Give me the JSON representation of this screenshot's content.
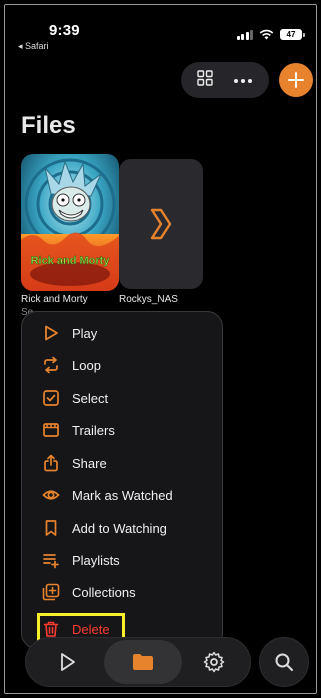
{
  "status_bar": {
    "time": "9:39",
    "back_app": "◂ Safari",
    "battery": "47"
  },
  "page": {
    "title": "Files"
  },
  "files": [
    {
      "name": "Rick and Morty",
      "subtitle": "Se",
      "poster_text": "Rick and Morty"
    },
    {
      "name": "Rockys_NAS"
    }
  ],
  "menu": {
    "items": [
      {
        "label": "Play",
        "icon": "play-icon"
      },
      {
        "label": "Loop",
        "icon": "loop-icon"
      },
      {
        "label": "Select",
        "icon": "checkbox-icon"
      },
      {
        "label": "Trailers",
        "icon": "film-icon"
      },
      {
        "label": "Share",
        "icon": "share-icon"
      },
      {
        "label": "Mark as Watched",
        "icon": "eye-icon"
      },
      {
        "label": "Add to Watching",
        "icon": "bookmark-icon"
      },
      {
        "label": "Playlists",
        "icon": "playlist-add-icon"
      },
      {
        "label": "Collections",
        "icon": "collection-add-icon"
      },
      {
        "label": "Delete",
        "icon": "trash-icon"
      }
    ]
  },
  "tabbar": {
    "tabs": [
      "play-tab",
      "files-tab",
      "settings-tab"
    ],
    "selected": "files-tab"
  },
  "colors": {
    "accent": "#e7832d",
    "danger": "#ff3b30",
    "highlight": "#f6ef2a"
  }
}
